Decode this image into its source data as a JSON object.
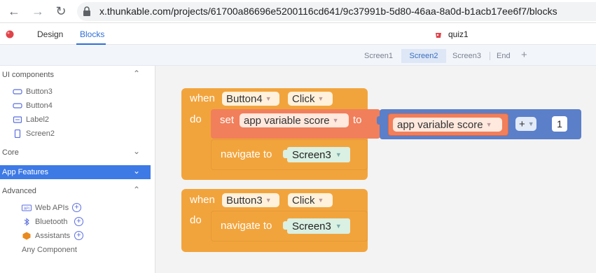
{
  "browser": {
    "url": "x.thunkable.com/projects/61700a86696e5200116cd641/9c37991b-5d80-46aa-8a0d-b1acb17ee6f7/blocks"
  },
  "header": {
    "tabs": [
      {
        "label": "Design",
        "active": false
      },
      {
        "label": "Blocks",
        "active": true
      }
    ],
    "project_name": "quiz1",
    "accent_color": "#2f6fd6"
  },
  "screens": {
    "tabs": [
      {
        "label": "Screen1",
        "active": false
      },
      {
        "label": "Screen2",
        "active": true
      },
      {
        "label": "Screen3",
        "active": false
      },
      {
        "label": "End",
        "active": false
      }
    ],
    "add_label": "+"
  },
  "sidebar": {
    "ui_components": {
      "title": "UI components",
      "expanded": true,
      "items": [
        {
          "label": "Button3",
          "icon": "button-icon"
        },
        {
          "label": "Button4",
          "icon": "button-icon"
        },
        {
          "label": "Label2",
          "icon": "label-icon"
        },
        {
          "label": "Screen2",
          "icon": "screen-icon"
        }
      ]
    },
    "core": {
      "title": "Core",
      "expanded": false
    },
    "app_features": {
      "title": "App Features",
      "expanded": false,
      "selected": true,
      "color": "#3d7ae6"
    },
    "advanced": {
      "title": "Advanced",
      "expanded": true,
      "items": [
        {
          "label": "Web APIs",
          "icon": "web-api-icon",
          "addable": true
        },
        {
          "label": "Bluetooth",
          "icon": "bluetooth-icon",
          "addable": true
        },
        {
          "label": "Assistants",
          "icon": "assistant-icon",
          "addable": true
        },
        {
          "label": "Any Component",
          "icon": "",
          "addable": false
        }
      ]
    }
  },
  "blocks": {
    "event1": {
      "when": "when",
      "component": "Button4",
      "event": "Click",
      "do": "do",
      "set": {
        "keyword": "set",
        "variable": "app variable score",
        "to": "to",
        "value": {
          "variable": "app variable score",
          "operator": "+",
          "number": "1"
        }
      },
      "navigate": {
        "keyword": "navigate to",
        "screen": "Screen3"
      }
    },
    "event2": {
      "when": "when",
      "component": "Button3",
      "event": "Click",
      "do": "do",
      "navigate": {
        "keyword": "navigate to",
        "screen": "Screen3"
      }
    }
  }
}
